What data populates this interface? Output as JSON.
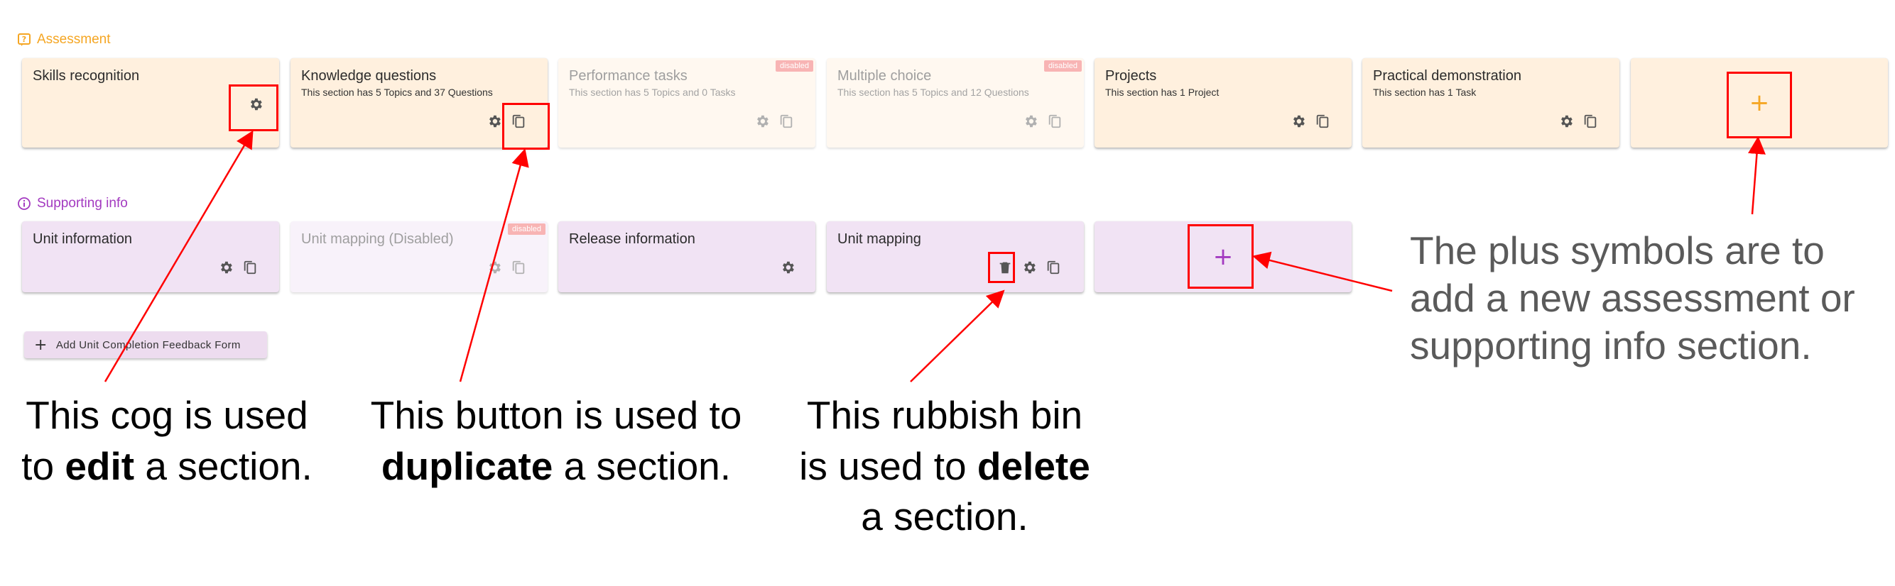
{
  "assessment": {
    "title": "Assessment",
    "cards": [
      {
        "title": "Skills recognition",
        "subtitle": "",
        "badge": ""
      },
      {
        "title": "Knowledge questions",
        "subtitle": "This section has 5 Topics and 37 Questions",
        "badge": ""
      },
      {
        "title": "Performance tasks",
        "subtitle": "This section has 5 Topics and 0 Tasks",
        "badge": "disabled"
      },
      {
        "title": "Multiple choice",
        "subtitle": "This section has 5 Topics and 12 Questions",
        "badge": "disabled"
      },
      {
        "title": "Projects",
        "subtitle": "This section has 1 Project",
        "badge": ""
      },
      {
        "title": "Practical demonstration",
        "subtitle": "This section has 1 Task",
        "badge": ""
      }
    ],
    "add_symbol": "+"
  },
  "supporting": {
    "title": "Supporting info",
    "cards": [
      {
        "title": "Unit information",
        "badge": ""
      },
      {
        "title": "Unit mapping (Disabled)",
        "badge": "disabled"
      },
      {
        "title": "Release information",
        "badge": ""
      },
      {
        "title": "Unit mapping",
        "badge": ""
      }
    ],
    "add_symbol": "+"
  },
  "feedback_button": {
    "label": "Add Unit Completion Feedback Form"
  },
  "annotations": {
    "edit": {
      "pre": "This cog is used",
      "line2_pre": "to ",
      "bold": "edit",
      "post": " a section."
    },
    "duplicate": {
      "pre": "This button is used to",
      "bold": "duplicate",
      "post": " a section."
    },
    "delete": {
      "pre": "This rubbish bin",
      "line2_pre": "is used to ",
      "bold": "delete",
      "post": "a section."
    },
    "plus": {
      "line1": "The plus symbols are to",
      "line2": "add a new assessment or",
      "line3": "supporting info section."
    }
  },
  "colors": {
    "assessment_accent": "#f5a623",
    "supporting_accent": "#a33ac0",
    "highlight": "#ff0000"
  },
  "icons": [
    "assessment-icon",
    "info-icon",
    "cog-icon",
    "duplicate-icon",
    "trash-icon",
    "plus-icon"
  ]
}
